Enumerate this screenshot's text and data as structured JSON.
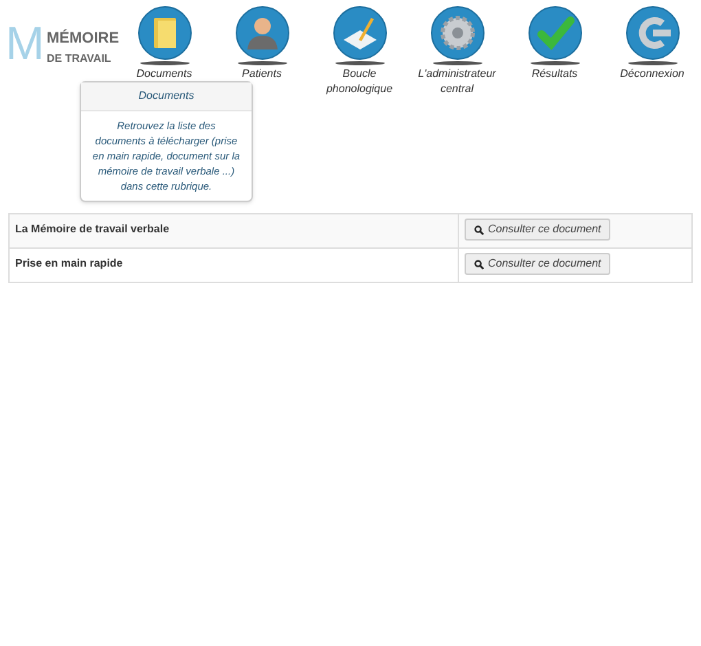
{
  "logo": {
    "letter": "M",
    "line_1": "MÉMOIRE",
    "line_2": "DE TRAVAIL"
  },
  "nav": [
    {
      "kind": "folder",
      "label": "Documents"
    },
    {
      "kind": "person",
      "label": "Patients"
    },
    {
      "kind": "pencil",
      "label": "Boucle phonologique"
    },
    {
      "kind": "gear",
      "label": "L'administrateur central"
    },
    {
      "kind": "check",
      "label": "Résultats"
    },
    {
      "kind": "logout",
      "label": "Déconnexion"
    }
  ],
  "tooltip": {
    "title": "Documents",
    "text": "Retrouvez la liste des documents à télécharger (prise en main rapide, document sur la mémoire de travail verbale ...) dans cette rubrique."
  },
  "documents": [
    {
      "name": "La Mémoire de travail verbale",
      "button": "Consulter ce document"
    },
    {
      "name": "Prise en main rapide",
      "button": "Consulter ce document"
    }
  ]
}
